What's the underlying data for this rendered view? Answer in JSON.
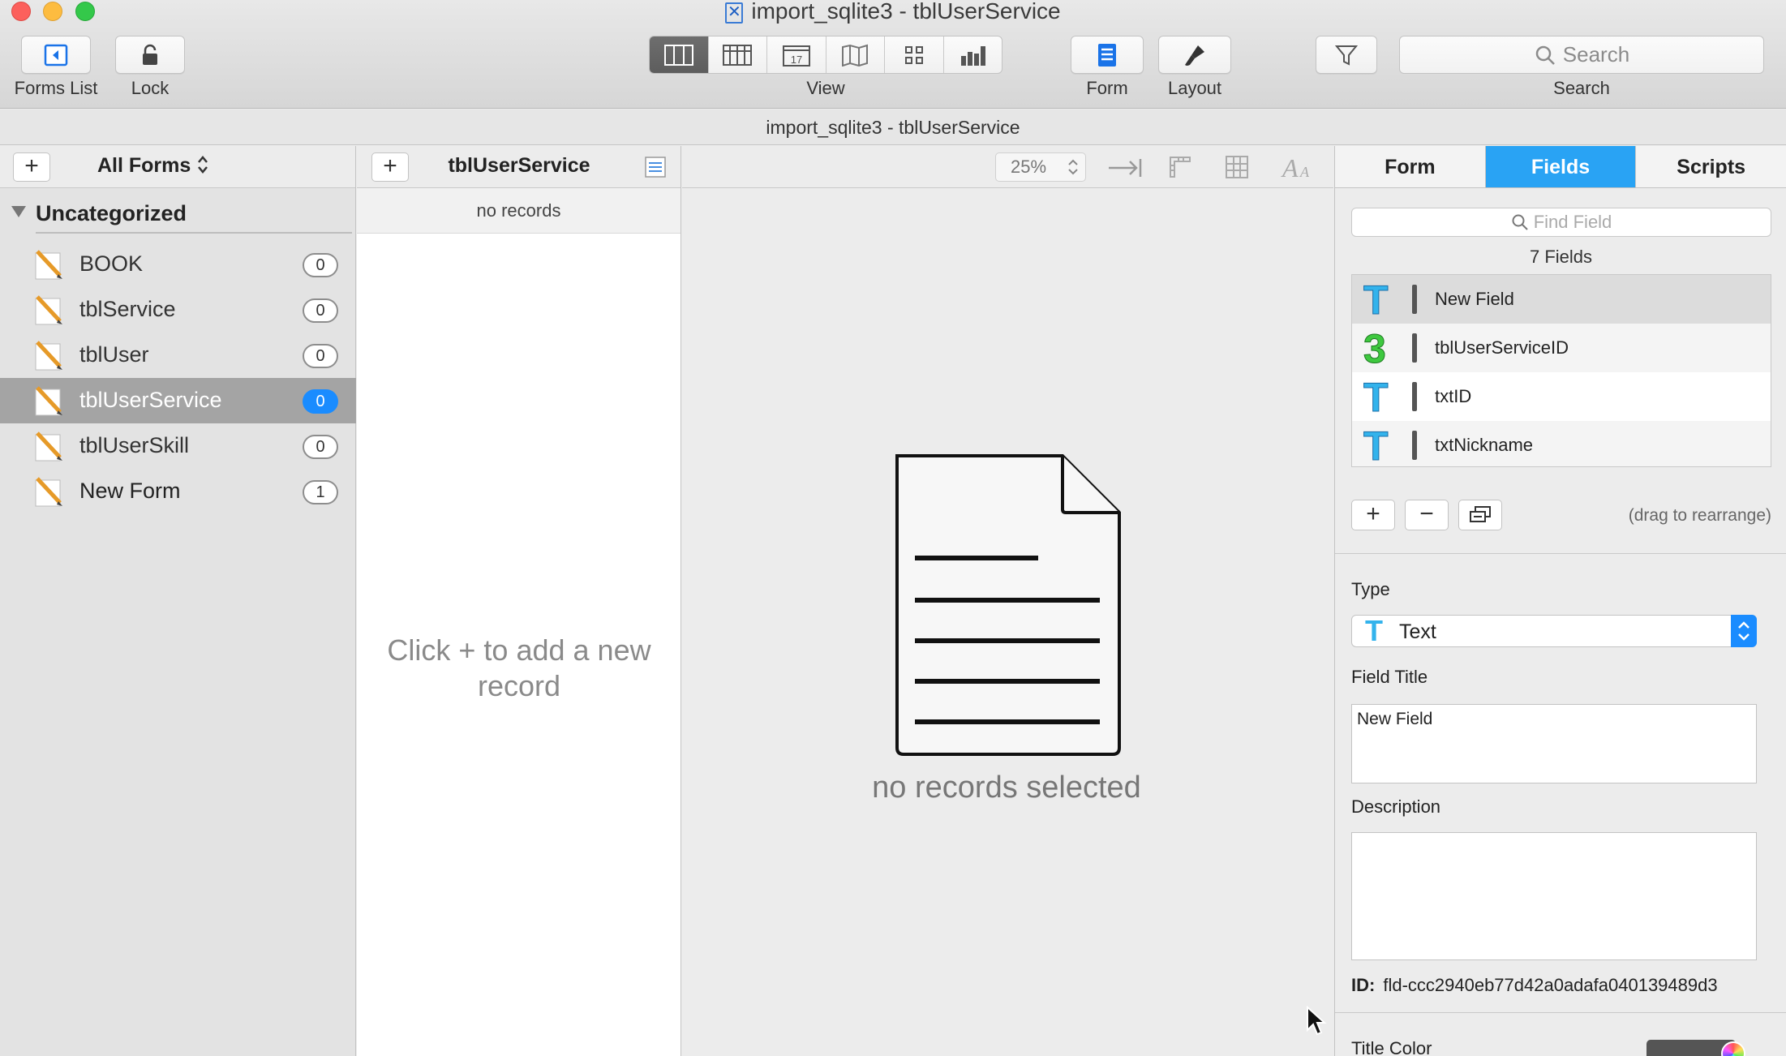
{
  "window": {
    "title": "import_sqlite3 - tblUserService",
    "subtitle": "import_sqlite3 - tblUserService"
  },
  "toolbar": {
    "forms_list_label": "Forms List",
    "lock_label": "Lock",
    "view_label": "View",
    "form_label": "Form",
    "layout_label": "Layout",
    "search_label": "Search",
    "search_placeholder": "Search"
  },
  "sidebar": {
    "header": "All Forms",
    "group": "Uncategorized",
    "items": [
      {
        "label": "BOOK",
        "count": "0"
      },
      {
        "label": "tblService",
        "count": "0"
      },
      {
        "label": "tblUser",
        "count": "0"
      },
      {
        "label": "tblUserService",
        "count": "0"
      },
      {
        "label": "tblUserSkill",
        "count": "0"
      },
      {
        "label": "New Form",
        "count": "1"
      }
    ]
  },
  "records": {
    "title": "tblUserService",
    "status": "no records",
    "hint": "Click + to add a new record"
  },
  "main": {
    "zoom": "25%",
    "empty_text": "no records selected"
  },
  "inspector": {
    "tabs": [
      "Form",
      "Fields",
      "Scripts"
    ],
    "find_placeholder": "Find Field",
    "field_count": "7 Fields",
    "fields": [
      {
        "icon": "T",
        "name": "New Field"
      },
      {
        "icon": "3",
        "name": "tblUserServiceID"
      },
      {
        "icon": "T",
        "name": "txtID"
      },
      {
        "icon": "T",
        "name": "txtNickname"
      }
    ],
    "drag_hint": "(drag to rearrange)",
    "type_label": "Type",
    "type_value": "Text",
    "field_title_label": "Field Title",
    "field_title_value": "New Field",
    "description_label": "Description",
    "id_label": "ID:",
    "id_value": "fld-ccc2940eb77d42a0adafa040139489d3",
    "title_color_label": "Title Color"
  },
  "colors": {
    "accent": "#29a3f4",
    "badge_selected": "#1a8cff"
  }
}
